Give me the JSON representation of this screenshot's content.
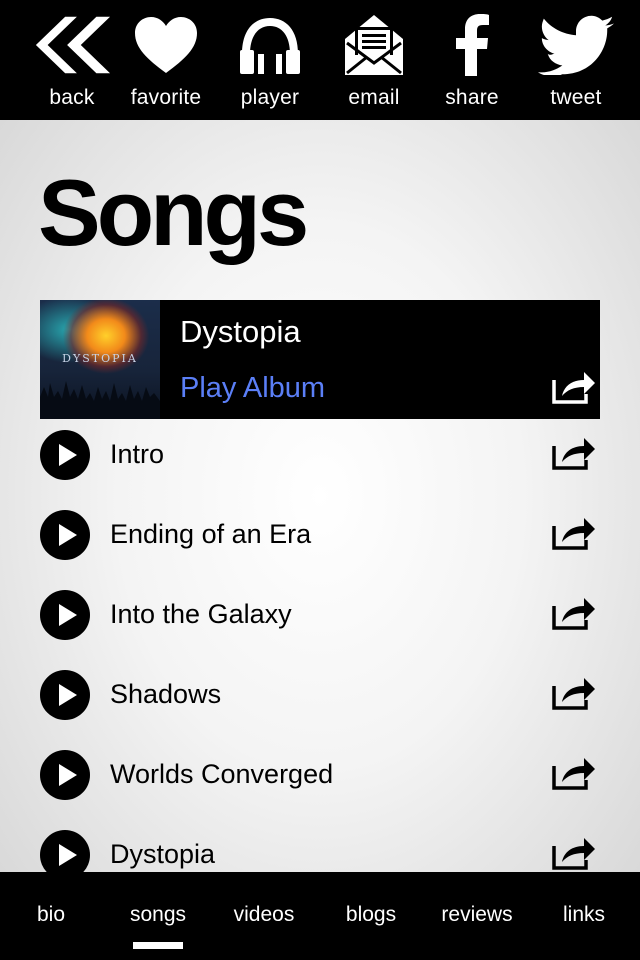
{
  "toolbar": {
    "items": [
      {
        "label": "back",
        "icon": "back-chevrons-icon"
      },
      {
        "label": "favorite",
        "icon": "heart-icon"
      },
      {
        "label": "player",
        "icon": "headphones-icon"
      },
      {
        "label": "email",
        "icon": "envelope-icon"
      },
      {
        "label": "share",
        "icon": "facebook-icon"
      },
      {
        "label": "tweet",
        "icon": "twitter-bird-icon"
      }
    ]
  },
  "page": {
    "title": "Songs"
  },
  "album": {
    "title": "Dystopia",
    "play_label": "Play Album",
    "art_text": "DYSTOPIA",
    "play_color": "#5b7ff7"
  },
  "tracks": [
    {
      "title": "Intro"
    },
    {
      "title": "Ending of an Era"
    },
    {
      "title": "Into the Galaxy"
    },
    {
      "title": "Shadows"
    },
    {
      "title": "Worlds Converged"
    },
    {
      "title": "Dystopia"
    }
  ],
  "bottom_nav": {
    "items": [
      {
        "label": "bio"
      },
      {
        "label": "songs"
      },
      {
        "label": "videos"
      },
      {
        "label": "blogs"
      },
      {
        "label": "reviews"
      },
      {
        "label": "links"
      }
    ],
    "selected": "songs"
  }
}
